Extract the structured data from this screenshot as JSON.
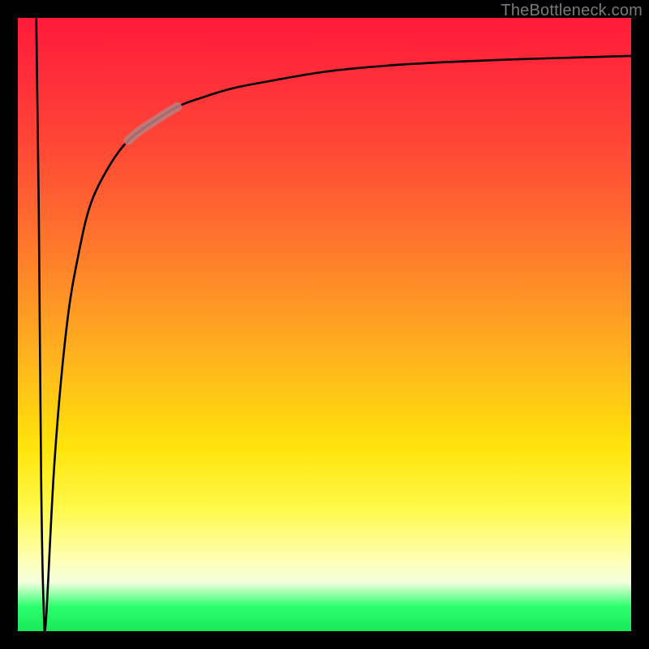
{
  "attribution": "TheBottleneck.com",
  "colors": {
    "background": "#000000",
    "gradient_top": "#ff1a3a",
    "gradient_mid": "#ffe40a",
    "gradient_bottom": "#18e85a",
    "curve": "#000000",
    "highlight": "#b98080"
  },
  "chart_data": {
    "type": "line",
    "title": "",
    "xlabel": "",
    "ylabel": "",
    "xlim": [
      0,
      100
    ],
    "ylim": [
      0,
      100
    ],
    "grid": false,
    "legend": false,
    "series": [
      {
        "name": "left-spike",
        "x": [
          3.0,
          3.4,
          3.8,
          4.2,
          4.6
        ],
        "values": [
          100,
          70,
          25,
          4,
          2
        ]
      },
      {
        "name": "main-curve",
        "x": [
          4.6,
          6,
          8,
          10,
          12,
          15,
          18,
          22,
          26,
          30,
          35,
          40,
          50,
          60,
          70,
          80,
          90,
          100
        ],
        "values": [
          2,
          28,
          50,
          62,
          70,
          76,
          80,
          83,
          85.5,
          87,
          88.5,
          89.5,
          91.2,
          92.2,
          92.8,
          93.2,
          93.5,
          93.8
        ]
      },
      {
        "name": "highlight-segment",
        "x": [
          18,
          20,
          22,
          24,
          26
        ],
        "values": [
          80,
          81.7,
          83,
          84.3,
          85.5
        ]
      }
    ]
  }
}
